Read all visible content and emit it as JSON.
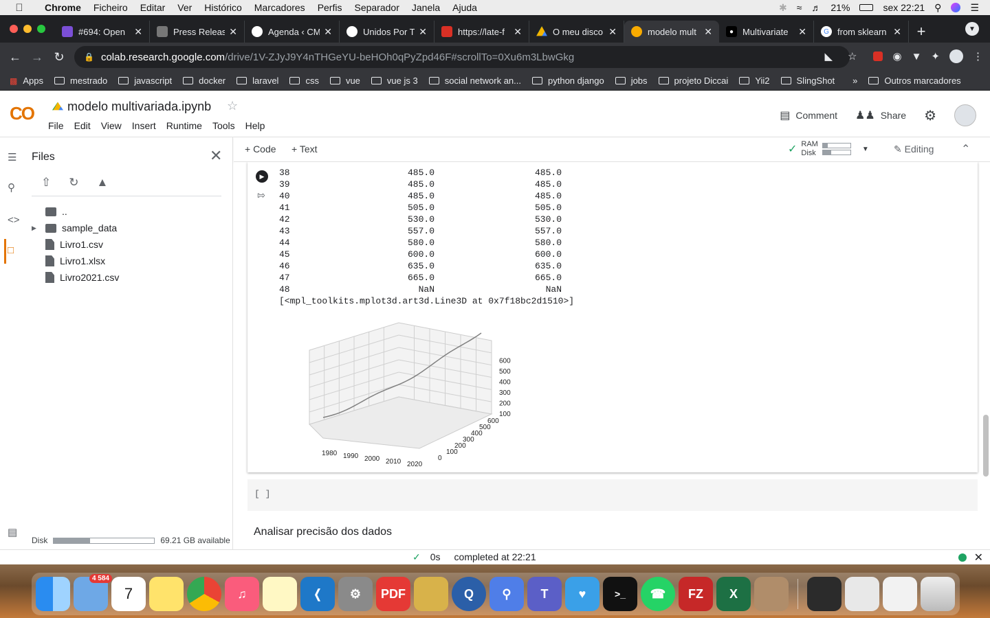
{
  "mac_menubar": {
    "app": "Chrome",
    "items": [
      "Ficheiro",
      "Editar",
      "Ver",
      "Histórico",
      "Marcadores",
      "Perfis",
      "Separador",
      "Janela",
      "Ajuda"
    ],
    "battery": "21%",
    "clock": "sex 22:21"
  },
  "tabs": [
    {
      "title": "#694: Open",
      "color": "#7b4fd6"
    },
    {
      "title": "Press Releas",
      "color": "#777777"
    },
    {
      "title": "Agenda ‹ CM",
      "color": "#444444"
    },
    {
      "title": "Unidos Por T",
      "color": "#444444"
    },
    {
      "title": "https://late-f",
      "color": "#d93025"
    },
    {
      "title": "O meu disco",
      "color": "#f4b400"
    },
    {
      "title": "modelo mult",
      "color": "#f9ab00"
    },
    {
      "title": "Multivariate",
      "color": "#000000"
    },
    {
      "title": "from sklearn",
      "color": "#4285f4"
    }
  ],
  "omnibox": {
    "host": "colab.research.google.com",
    "path": "/drive/1V-ZJyJ9Y4nTHGeYU-beHOh0qPyZpd46F#scrollTo=0Xu6m3LbwGkg"
  },
  "bookmarks": [
    "Apps",
    "mestrado",
    "javascript",
    "docker",
    "laravel",
    "css",
    "vue",
    "vue js 3",
    "social network an...",
    "python django",
    "jobs",
    "projeto Diccai",
    "Yii2",
    "SlingShot",
    "»",
    "Outros marcadores"
  ],
  "colab": {
    "logo": "CO",
    "notebook_title": "modelo multivariada.ipynb",
    "menu": [
      "File",
      "Edit",
      "View",
      "Insert",
      "Runtime",
      "Tools",
      "Help"
    ],
    "comment": "Comment",
    "share": "Share"
  },
  "sidebar": {
    "title": "Files",
    "items": [
      "..",
      "sample_data",
      "Livro1.csv",
      "Livro1.xlsx",
      "Livro2021.csv"
    ],
    "disk_label": "Disk",
    "disk_available": "69.21 GB available",
    "disk_used_fraction": 0.36
  },
  "toolbar": {
    "code": "+ Code",
    "text": "+ Text",
    "ram": "RAM",
    "disk": "Disk",
    "editing": "Editing"
  },
  "output": {
    "rows": [
      {
        "i": "38",
        "a": "485.0",
        "b": "485.0"
      },
      {
        "i": "39",
        "a": "485.0",
        "b": "485.0"
      },
      {
        "i": "40",
        "a": "485.0",
        "b": "485.0"
      },
      {
        "i": "41",
        "a": "505.0",
        "b": "505.0"
      },
      {
        "i": "42",
        "a": "530.0",
        "b": "530.0"
      },
      {
        "i": "43",
        "a": "557.0",
        "b": "557.0"
      },
      {
        "i": "44",
        "a": "580.0",
        "b": "580.0"
      },
      {
        "i": "45",
        "a": "600.0",
        "b": "600.0"
      },
      {
        "i": "46",
        "a": "635.0",
        "b": "635.0"
      },
      {
        "i": "47",
        "a": "665.0",
        "b": "665.0"
      },
      {
        "i": "48",
        "a": "NaN",
        "b": "NaN"
      }
    ],
    "repr": "[<mpl_toolkits.mplot3d.art3d.Line3D at 0x7f18bc2d1510>]"
  },
  "chart_data": {
    "type": "line",
    "x_ticks": [
      "1980",
      "1990",
      "2000",
      "2010",
      "2020"
    ],
    "y_ticks": [
      "0",
      "100",
      "200",
      "300",
      "400",
      "500",
      "600"
    ],
    "z_ticks": [
      "100",
      "200",
      "300",
      "400",
      "500",
      "600"
    ]
  },
  "empty_cell": "[ ]",
  "markdown": "Analisar precisão dos dados",
  "status": {
    "time": "0s",
    "message": "completed at 22:21"
  }
}
